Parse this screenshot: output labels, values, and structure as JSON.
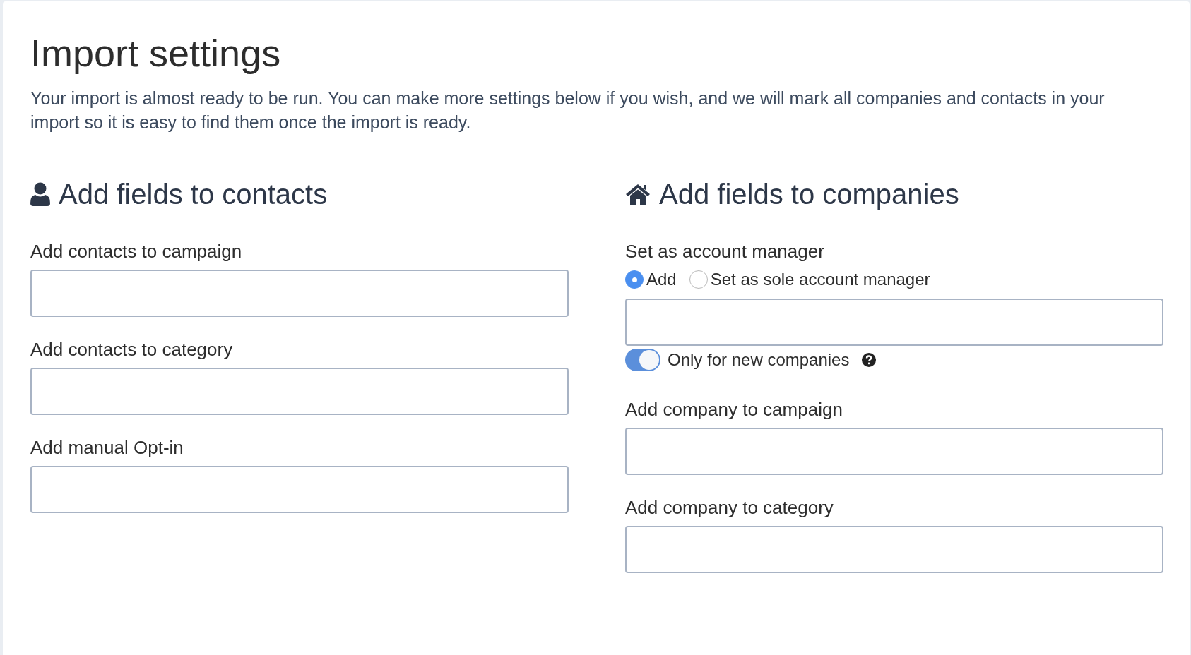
{
  "title": "Import settings",
  "intro": "Your import is almost ready to be run. You can make more settings below if you wish, and we will mark all companies and contacts in your import so it is easy to find them once the import is ready.",
  "contacts": {
    "heading": "Add fields to contacts",
    "fields": [
      {
        "label": "Add contacts to campaign"
      },
      {
        "label": "Add contacts to category"
      },
      {
        "label": "Add manual Opt-in"
      }
    ]
  },
  "companies": {
    "heading": "Add fields to companies",
    "account_manager": {
      "label": "Set as account manager",
      "options": [
        {
          "label": "Add",
          "selected": true
        },
        {
          "label": "Set as sole account manager",
          "selected": false
        }
      ],
      "only_new": {
        "label": "Only for new companies",
        "on": true
      }
    },
    "fields": [
      {
        "label": "Add company to campaign"
      },
      {
        "label": "Add company to category"
      }
    ]
  }
}
